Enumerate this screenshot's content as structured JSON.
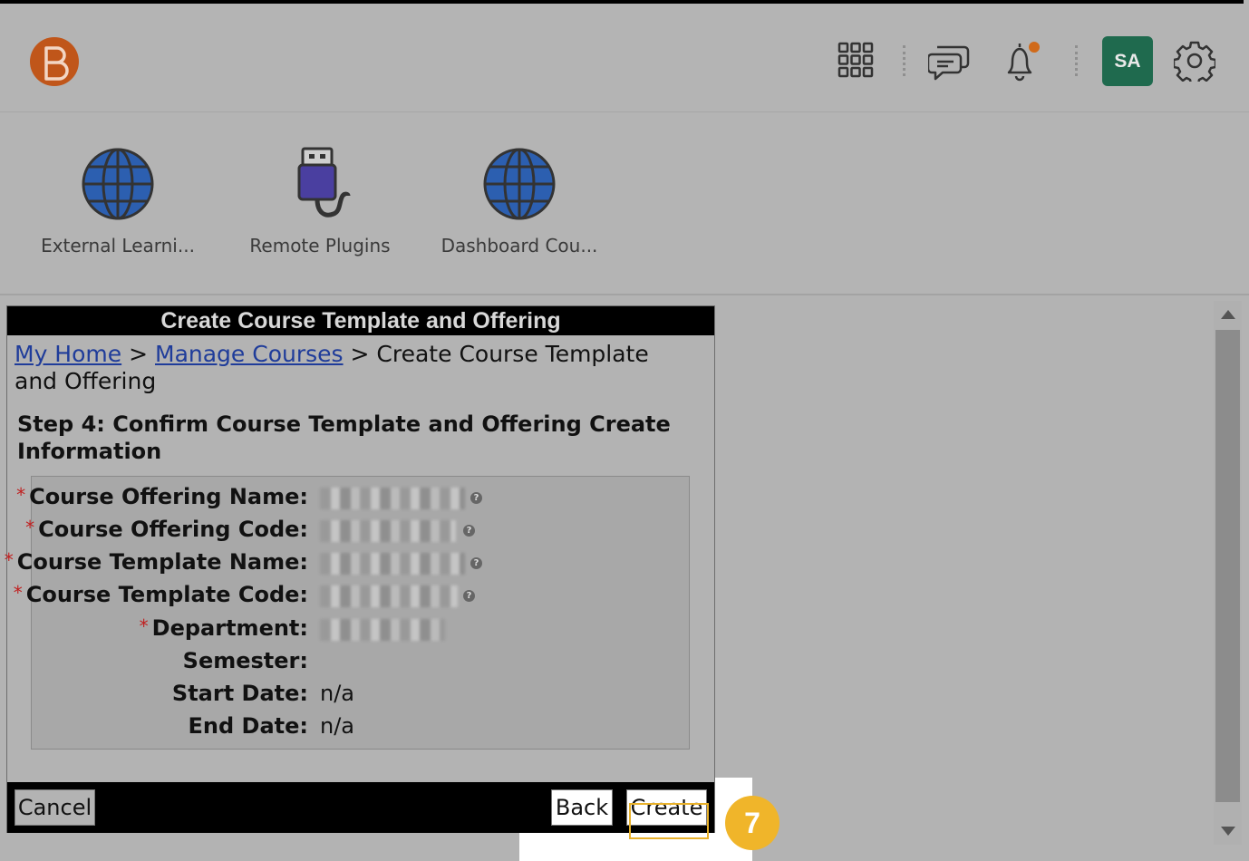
{
  "navbar": {
    "logo_alt": "B",
    "avatar_initials": "SA"
  },
  "widgets": [
    {
      "label": "External Learni...",
      "icon": "globe-icon"
    },
    {
      "label": "Remote Plugins",
      "icon": "usb-plug-icon"
    },
    {
      "label": "Dashboard Cou...",
      "icon": "globe-icon"
    }
  ],
  "dialog": {
    "title": "Create Course Template and Offering",
    "breadcrumb": {
      "home": "My Home",
      "manage": "Manage Courses",
      "sep": ">",
      "current": "Create Course Template and Offering"
    },
    "step_title": "Step 4: Confirm Course Template and Offering Create Information",
    "fields": [
      {
        "label": "Course Offering Name:",
        "required": true,
        "value": "",
        "blurred": true,
        "help": true
      },
      {
        "label": "Course Offering Code:",
        "required": true,
        "value": "",
        "blurred": true,
        "help": true
      },
      {
        "label": "Course Template Name:",
        "required": true,
        "value": "",
        "blurred": true,
        "help": true
      },
      {
        "label": "Course Template Code:",
        "required": true,
        "value": "",
        "blurred": true,
        "help": true
      },
      {
        "label": "Department:",
        "required": true,
        "value": "",
        "blurred": true,
        "help": false
      },
      {
        "label": "Semester:",
        "required": false,
        "value": "",
        "blurred": false,
        "help": false
      },
      {
        "label": "Start Date:",
        "required": false,
        "value": "n/a",
        "blurred": false,
        "help": false
      },
      {
        "label": "End Date:",
        "required": false,
        "value": "n/a",
        "blurred": false,
        "help": false
      }
    ],
    "buttons": {
      "cancel": "Cancel",
      "back": "Back",
      "create": "Create"
    }
  },
  "annotation": {
    "step_number": "7",
    "accent_color": "#f0b52a"
  },
  "req_mark": "*",
  "help_mark": "?"
}
